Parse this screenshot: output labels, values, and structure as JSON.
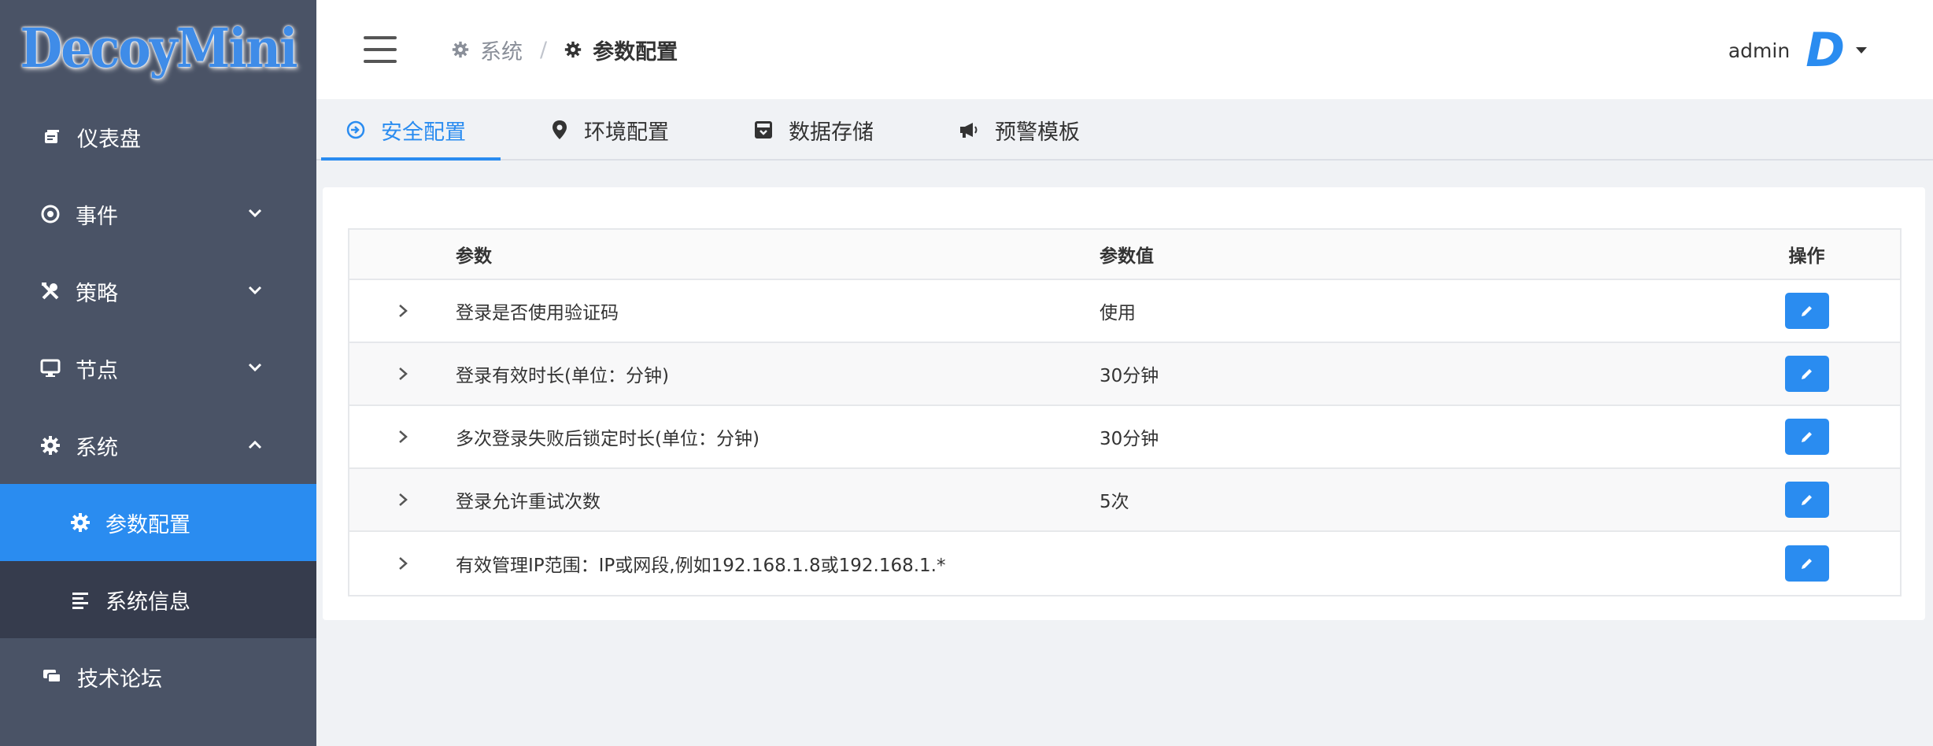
{
  "app": {
    "logo_text": "DecoyMini"
  },
  "sidebar": {
    "items": [
      {
        "label": "仪表盘",
        "icon": "dashboard-icon"
      },
      {
        "label": "事件",
        "icon": "eye-icon"
      },
      {
        "label": "策略",
        "icon": "tools-icon"
      },
      {
        "label": "节点",
        "icon": "monitor-icon"
      },
      {
        "label": "系统",
        "icon": "gear-icon"
      },
      {
        "label": "参数配置",
        "icon": "gear-icon"
      },
      {
        "label": "系统信息",
        "icon": "list-icon"
      },
      {
        "label": "技术论坛",
        "icon": "chat-icon"
      }
    ]
  },
  "header": {
    "breadcrumb": {
      "parent": "系统",
      "separator": "/",
      "current": "参数配置"
    },
    "user": {
      "name": "admin",
      "avatar_letter": "D"
    }
  },
  "tabs": [
    {
      "label": "安全配置",
      "icon": "sign-in-icon",
      "active": true
    },
    {
      "label": "环境配置",
      "icon": "map-marker-icon",
      "active": false
    },
    {
      "label": "数据存储",
      "icon": "archive-icon",
      "active": false
    },
    {
      "label": "预警模板",
      "icon": "megaphone-icon",
      "active": false
    }
  ],
  "table": {
    "columns": {
      "param": "参数",
      "value": "参数值",
      "op": "操作"
    },
    "rows": [
      {
        "param": "登录是否使用验证码",
        "value": "使用"
      },
      {
        "param": "登录有效时长(单位：分钟)",
        "value": "30分钟"
      },
      {
        "param": "多次登录失败后锁定时长(单位：分钟)",
        "value": "30分钟"
      },
      {
        "param": "登录允许重试次数",
        "value": "5次"
      },
      {
        "param": "有效管理IP范围：IP或网段,例如192.168.1.8或192.168.1.*",
        "value": ""
      }
    ]
  },
  "colors": {
    "accent": "#2a8cf0",
    "sidebar_bg": "#4a5366",
    "submenu_bg": "#363c4d"
  }
}
